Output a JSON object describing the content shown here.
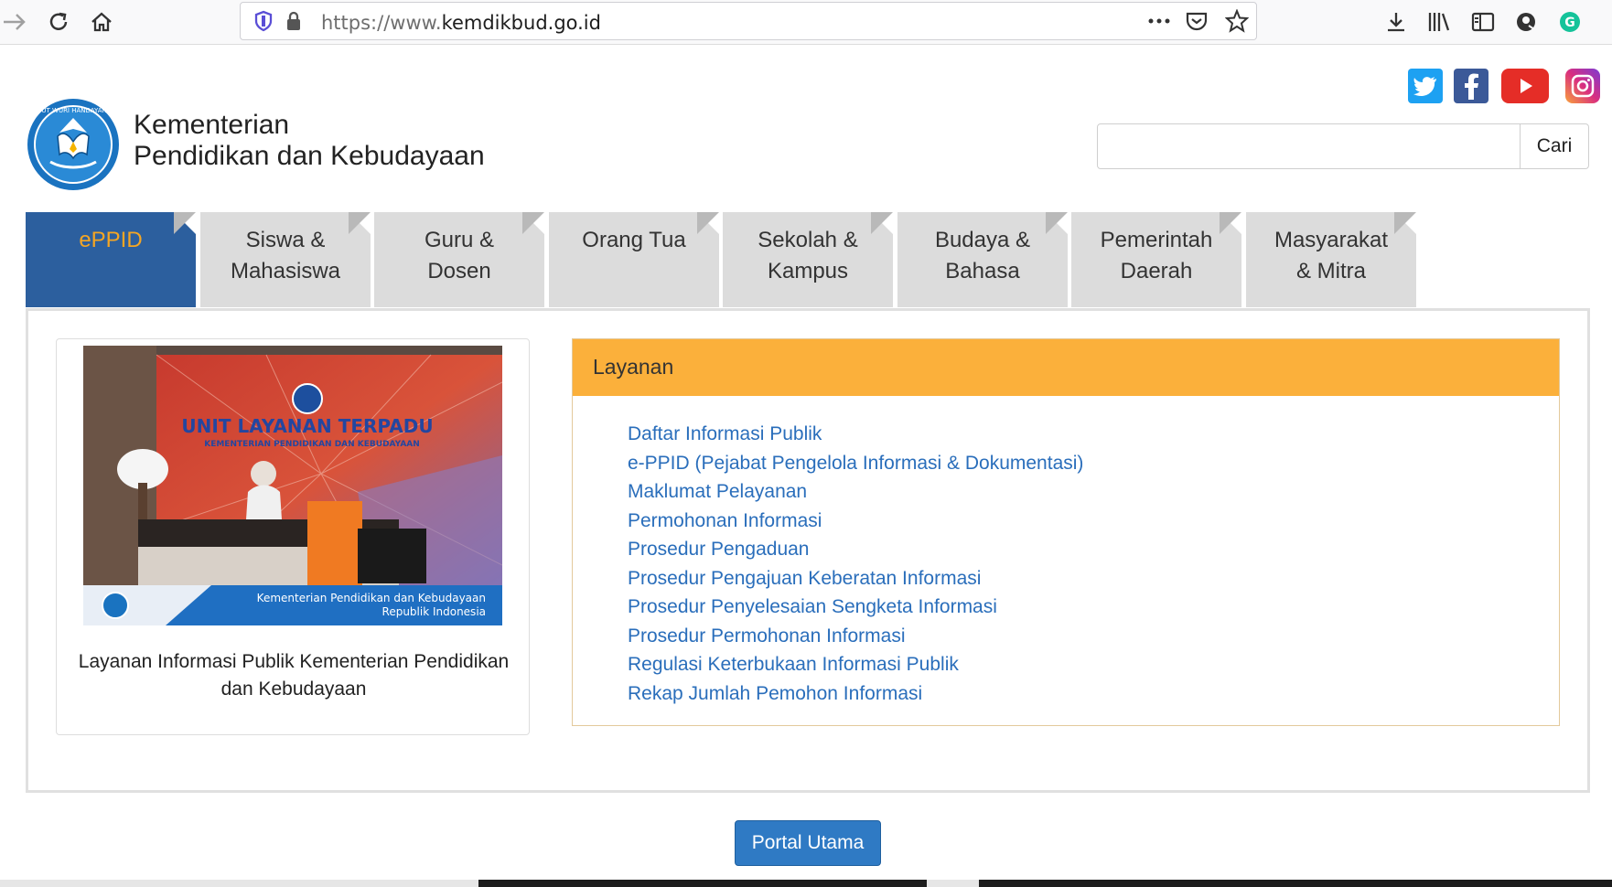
{
  "browser": {
    "url_prefix": "https://www.",
    "url_domain": "kemdikbud.go.id",
    "toolbar_icons": [
      "forward-icon",
      "reload-icon",
      "home-icon",
      "shield-icon",
      "lock-icon",
      "more-icon",
      "pocket-icon",
      "star-icon",
      "download-icon",
      "library-icon",
      "reader-icon",
      "account-icon",
      "grammarly-icon"
    ]
  },
  "header": {
    "title_line1": "Kementerian",
    "title_line2": "Pendidikan dan Kebudayaan",
    "search_placeholder": "",
    "search_button": "Cari",
    "social": [
      "twitter-icon",
      "facebook-icon",
      "youtube-icon",
      "instagram-icon"
    ]
  },
  "tabs": [
    {
      "line1": "ePPID",
      "line2": ""
    },
    {
      "line1": "Siswa &",
      "line2": "Mahasiswa"
    },
    {
      "line1": "Guru &",
      "line2": "Dosen"
    },
    {
      "line1": "Orang Tua",
      "line2": ""
    },
    {
      "line1": "Sekolah &",
      "line2": "Kampus"
    },
    {
      "line1": "Budaya &",
      "line2": "Bahasa"
    },
    {
      "line1": "Pemerintah",
      "line2": "Daerah"
    },
    {
      "line1": "Masyarakat",
      "line2": "& Mitra"
    }
  ],
  "photo": {
    "sign_title": "UNIT LAYANAN TERPADU",
    "sign_subtitle": "KEMENTERIAN PENDIDIKAN DAN KEBUDAYAAN",
    "banner_line1": "Kementerian Pendidikan dan Kebudayaan",
    "banner_line2": "Republik Indonesia",
    "caption": "Layanan Informasi Publik Kementerian Pendidikan dan Kebudayaan"
  },
  "panel": {
    "title": "Layanan",
    "links": [
      "Daftar Informasi Publik",
      "e-PPID (Pejabat Pengelola Informasi & Dokumentasi)",
      "Maklumat Pelayanan",
      "Permohonan Informasi",
      "Prosedur Pengaduan",
      "Prosedur Pengajuan Keberatan Informasi",
      "Prosedur Penyelesaian Sengketa Informasi",
      "Prosedur Permohonan Informasi",
      "Regulasi Keterbukaan Informasi Publik",
      "Rekap Jumlah Pemohon Informasi"
    ]
  },
  "footer": {
    "portal_button": "Portal Utama"
  },
  "colors": {
    "active_tab_bg": "#2c5f9e",
    "active_tab_text": "#f5a623",
    "panel_header": "#fbb03b",
    "link": "#2a6ebb",
    "portal_button": "#2f7ac4"
  }
}
